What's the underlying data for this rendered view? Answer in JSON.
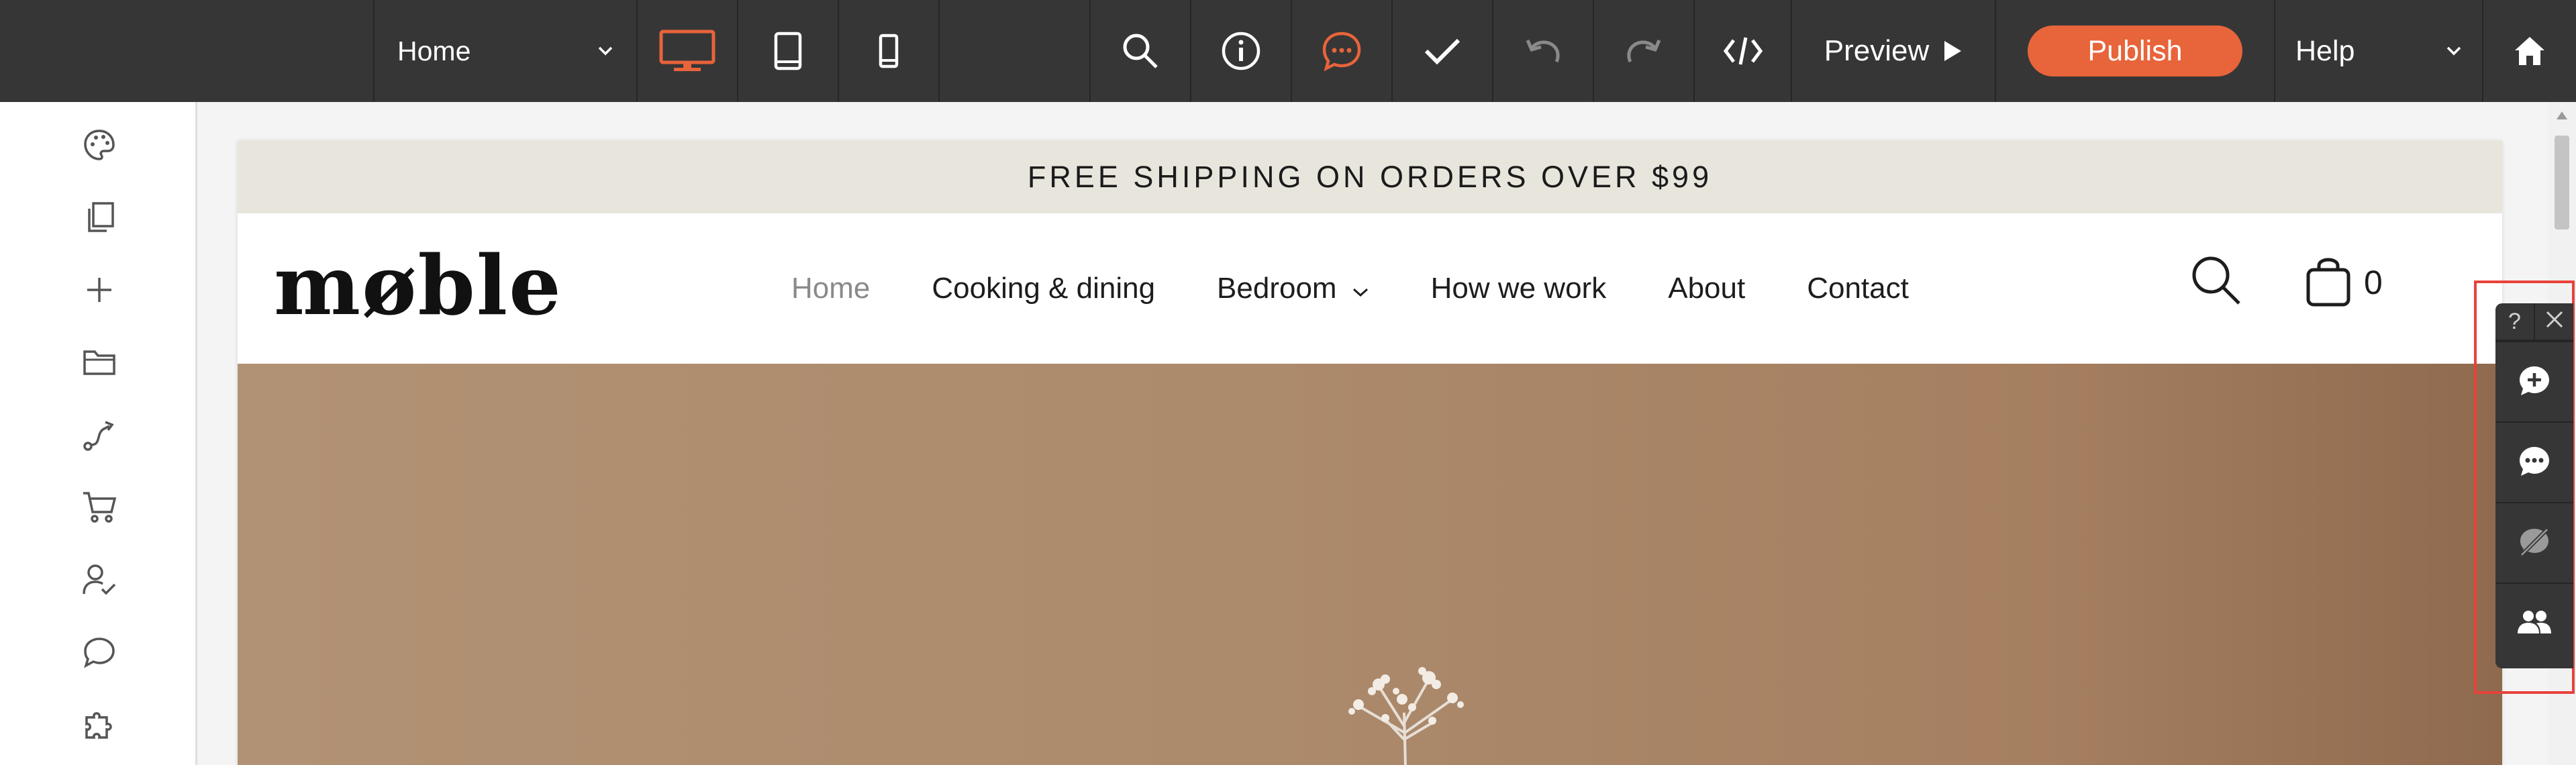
{
  "toolbar": {
    "page_select": {
      "value": "Home"
    },
    "devices": [
      "desktop-icon",
      "tablet-icon",
      "mobile-icon"
    ],
    "active_device": "desktop",
    "tools": [
      "search-icon",
      "info-icon",
      "comments-icon",
      "check-icon",
      "undo-icon",
      "redo-icon",
      "code-icon"
    ],
    "preview_label": "Preview",
    "publish_label": "Publish",
    "help_label": "Help",
    "accent": "#e8643a",
    "background": "#363636"
  },
  "sidebar": {
    "items": [
      "palette-icon",
      "pages-icon",
      "add-icon",
      "folder-icon",
      "route-icon",
      "cart-icon",
      "user-check-icon",
      "chat-icon",
      "puzzle-icon"
    ]
  },
  "site": {
    "announcement": "FREE SHIPPING ON ORDERS OVER $99",
    "logo": "møble",
    "nav": [
      {
        "label": "Home",
        "active": true
      },
      {
        "label": "Cooking & dining"
      },
      {
        "label": "Bedroom",
        "has_dropdown": true
      },
      {
        "label": "How we work"
      },
      {
        "label": "About"
      },
      {
        "label": "Contact"
      }
    ],
    "cart_count": "0",
    "announcement_bg": "#e8e5dc",
    "hero_color": "#ac8a6c"
  },
  "comment_toolbar": {
    "help_glyph": "?",
    "close_glyph": "×",
    "buttons": [
      "add-comment-icon",
      "comment-icon",
      "hide-comments-icon",
      "collaborators-icon"
    ],
    "highlight_color": "#e8423c"
  }
}
